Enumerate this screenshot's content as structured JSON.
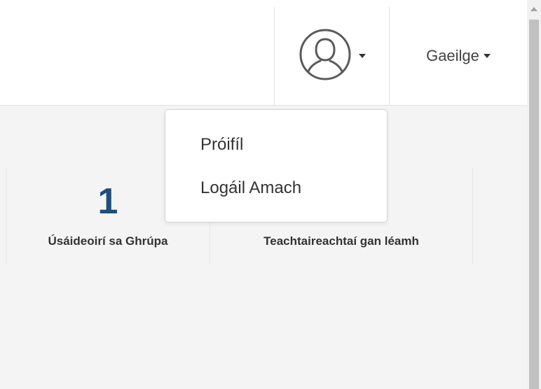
{
  "header": {
    "language": {
      "label": "Gaeilge",
      "icon": "caret-down-icon"
    },
    "user_menu": {
      "avatar_icon": "user-avatar-icon",
      "caret_icon": "caret-down-icon"
    }
  },
  "dropdown": {
    "items": [
      {
        "label": "Próifíl"
      },
      {
        "label": "Logáil Amach"
      }
    ]
  },
  "stats": [
    {
      "value": "1",
      "label": "Úsáideoirí sa Ghrúpa"
    },
    {
      "value": "",
      "label": "Teachtaireachtaí gan léamh"
    }
  ],
  "colors": {
    "accent": "#1f4e79",
    "text": "#333333",
    "content_bg": "#f4f4f4",
    "border": "#e2e2e2"
  }
}
